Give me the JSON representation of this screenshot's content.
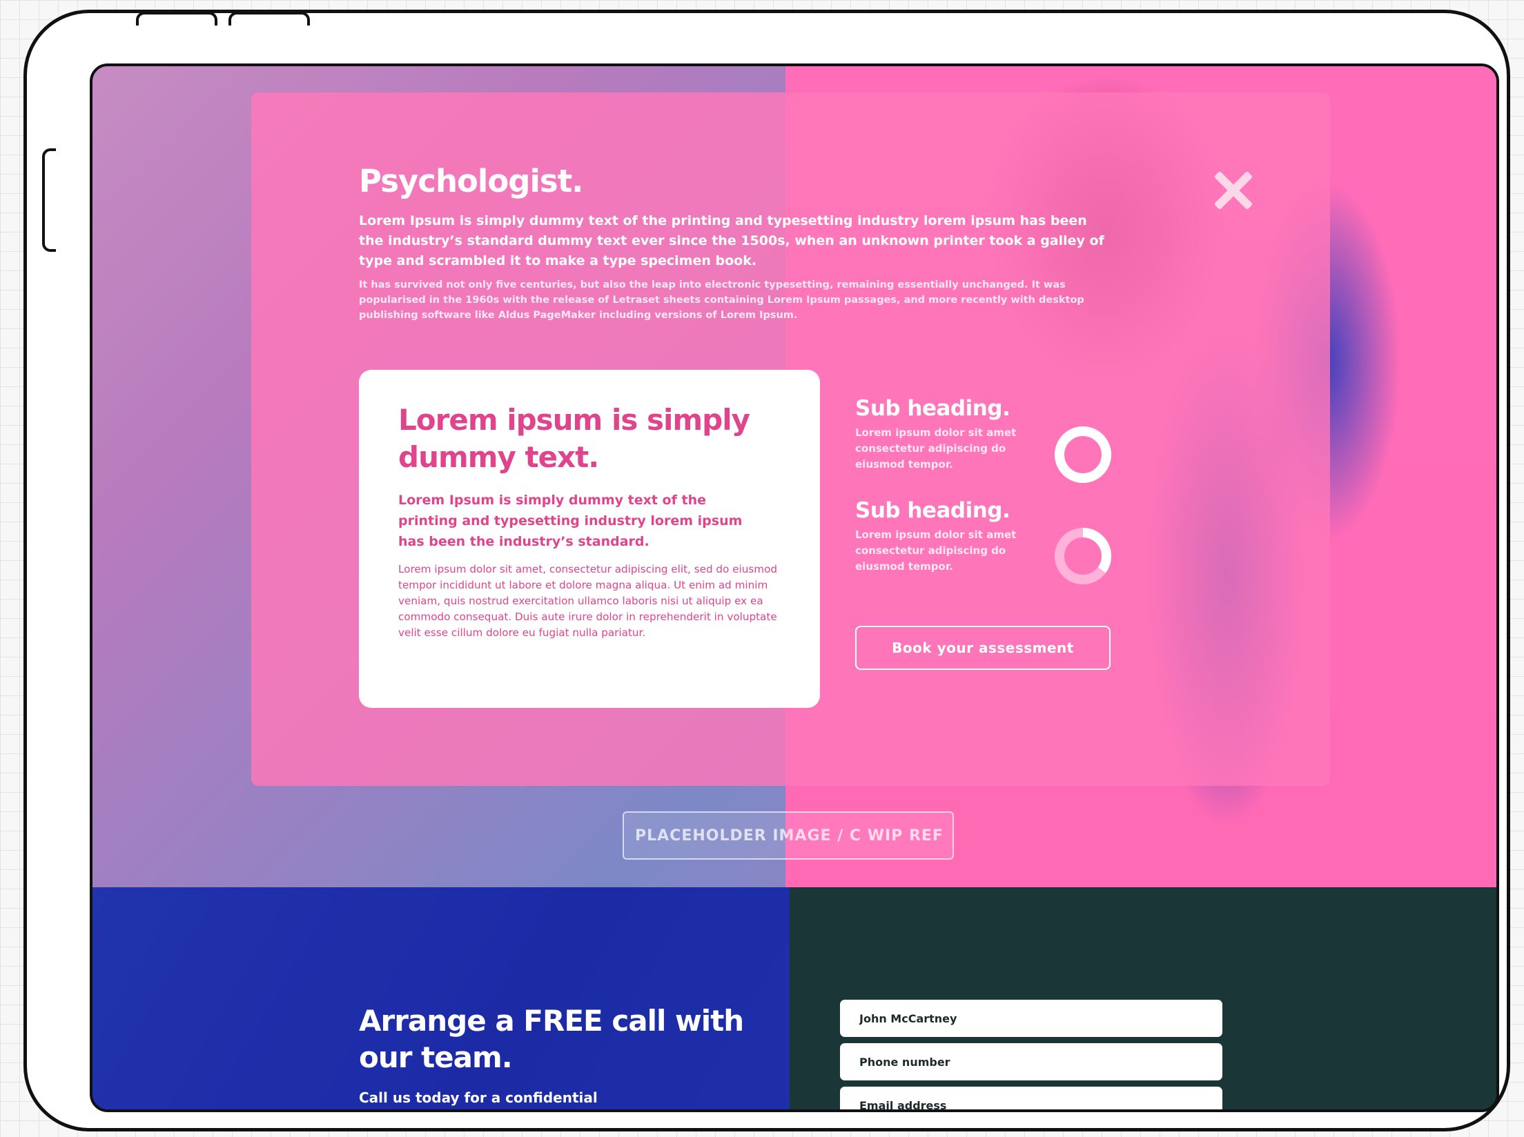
{
  "modal": {
    "title": "Psychologist.",
    "lead": "Lorem Ipsum is simply dummy text of the printing and typesetting industry lorem ipsum has been the industry’s standard dummy text ever since the 1500s, when an unknown printer took a galley of type and scrambled it to make a type specimen book.",
    "body": "It has survived not only five centuries, but also the leap into electronic typesetting, remaining essentially unchanged. It was popularised in the 1960s with the release of Letraset sheets containing Lorem Ipsum passages, and more recently with desktop publishing software like Aldus PageMaker including versions of Lorem Ipsum.",
    "card": {
      "title": "Lorem ipsum is simply dummy text.",
      "lead": "Lorem Ipsum is simply dummy text of the printing and typesetting industry lorem ipsum has been the industry’s standard.",
      "body": "Lorem ipsum dolor sit amet, consectetur adipiscing elit, sed do eiusmod tempor incididunt ut labore et dolore magna aliqua. Ut enim ad minim veniam, quis nostrud exercitation ullamco laboris nisi ut aliquip ex ea commodo consequat. Duis aute irure dolor in reprehenderit in voluptate velit esse cillum dolore eu fugiat nulla pariatur."
    },
    "subsections": [
      {
        "heading": "Sub heading.",
        "text": "Lorem ipsum dolor sit amet consectetur adipiscing do eiusmod tempor.",
        "ring_fill": 1.0
      },
      {
        "heading": "Sub heading.",
        "text": "Lorem ipsum dolor sit amet consectetur adipiscing do eiusmod tempor.",
        "ring_fill": 0.35
      }
    ],
    "cta_label": "Book your assessment"
  },
  "placeholder_label": "PLACEHOLDER IMAGE / C WIP REF",
  "callout": {
    "heading": "Arrange a FREE call with our team.",
    "sub": "Call us today for a confidential"
  },
  "form": {
    "name_value": "John McCartney",
    "phone_placeholder": "Phone number",
    "email_placeholder": "Email address"
  },
  "colors": {
    "accent_pink": "#ff6ab5",
    "card_text": "#e0448c",
    "cta_blue": "#1e2dab",
    "form_bg": "#1b3636"
  },
  "icons": {
    "close": "close-icon",
    "progress_ring": "progress-ring-icon"
  }
}
